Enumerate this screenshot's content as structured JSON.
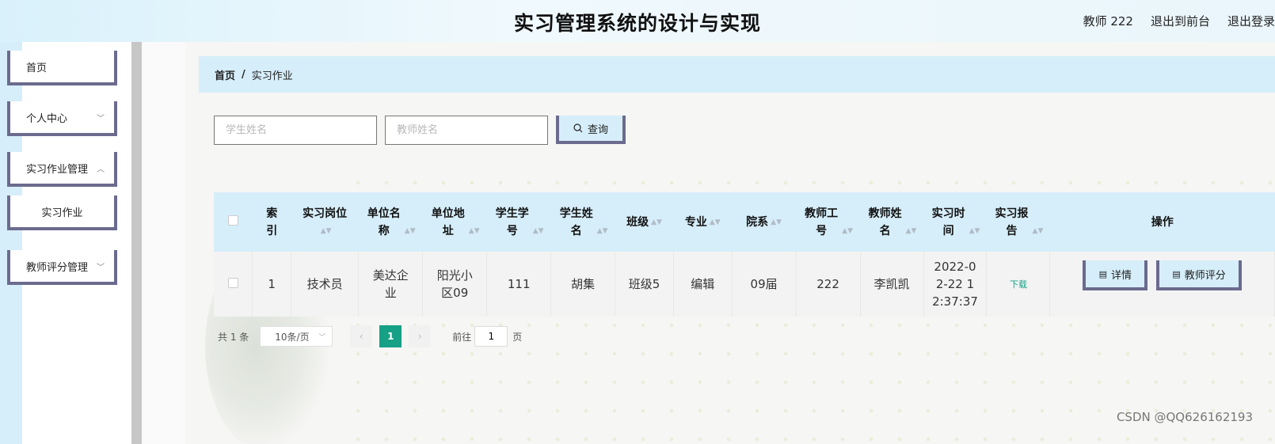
{
  "header": {
    "title": "实习管理系统的设计与实现",
    "user": "教师 222",
    "to_front": "退出到前台",
    "logout": "退出登录"
  },
  "sidebar": {
    "items": [
      {
        "label": "首页"
      },
      {
        "label": "个人中心"
      },
      {
        "label": "实习作业管理"
      },
      {
        "label": "实习作业"
      },
      {
        "label": "教师评分管理"
      }
    ]
  },
  "breadcrumb": {
    "root": "首页",
    "separator": "/",
    "current": "实习作业"
  },
  "search": {
    "student_placeholder": "学生姓名",
    "teacher_placeholder": "教师姓名",
    "button_label": "查询"
  },
  "table": {
    "columns": [
      "索引",
      "实习岗位",
      "单位名称",
      "单位地址",
      "学生学号",
      "学生姓名",
      "班级",
      "专业",
      "院系",
      "教师工号",
      "教师姓名",
      "实习时间",
      "实习报告",
      "操作"
    ],
    "rows": [
      {
        "index": "1",
        "position": "技术员",
        "company": "美达企业",
        "address": "阳光小区09",
        "student_no": "111",
        "student_name": "胡集",
        "class": "班级5",
        "major": "编辑",
        "department": "09届",
        "teacher_no": "222",
        "teacher_name": "李凯凯",
        "time": "2022-02-22 12:37:37",
        "report": "下载",
        "detail_label": "详情",
        "score_label": "教师评分"
      }
    ]
  },
  "pagination": {
    "total": "共 1 条",
    "page_size": "10条/页",
    "current_page": "1",
    "goto_label": "前往",
    "goto_value": "1",
    "page_suffix": "页"
  },
  "watermark": "CSDN @QQ626162193"
}
